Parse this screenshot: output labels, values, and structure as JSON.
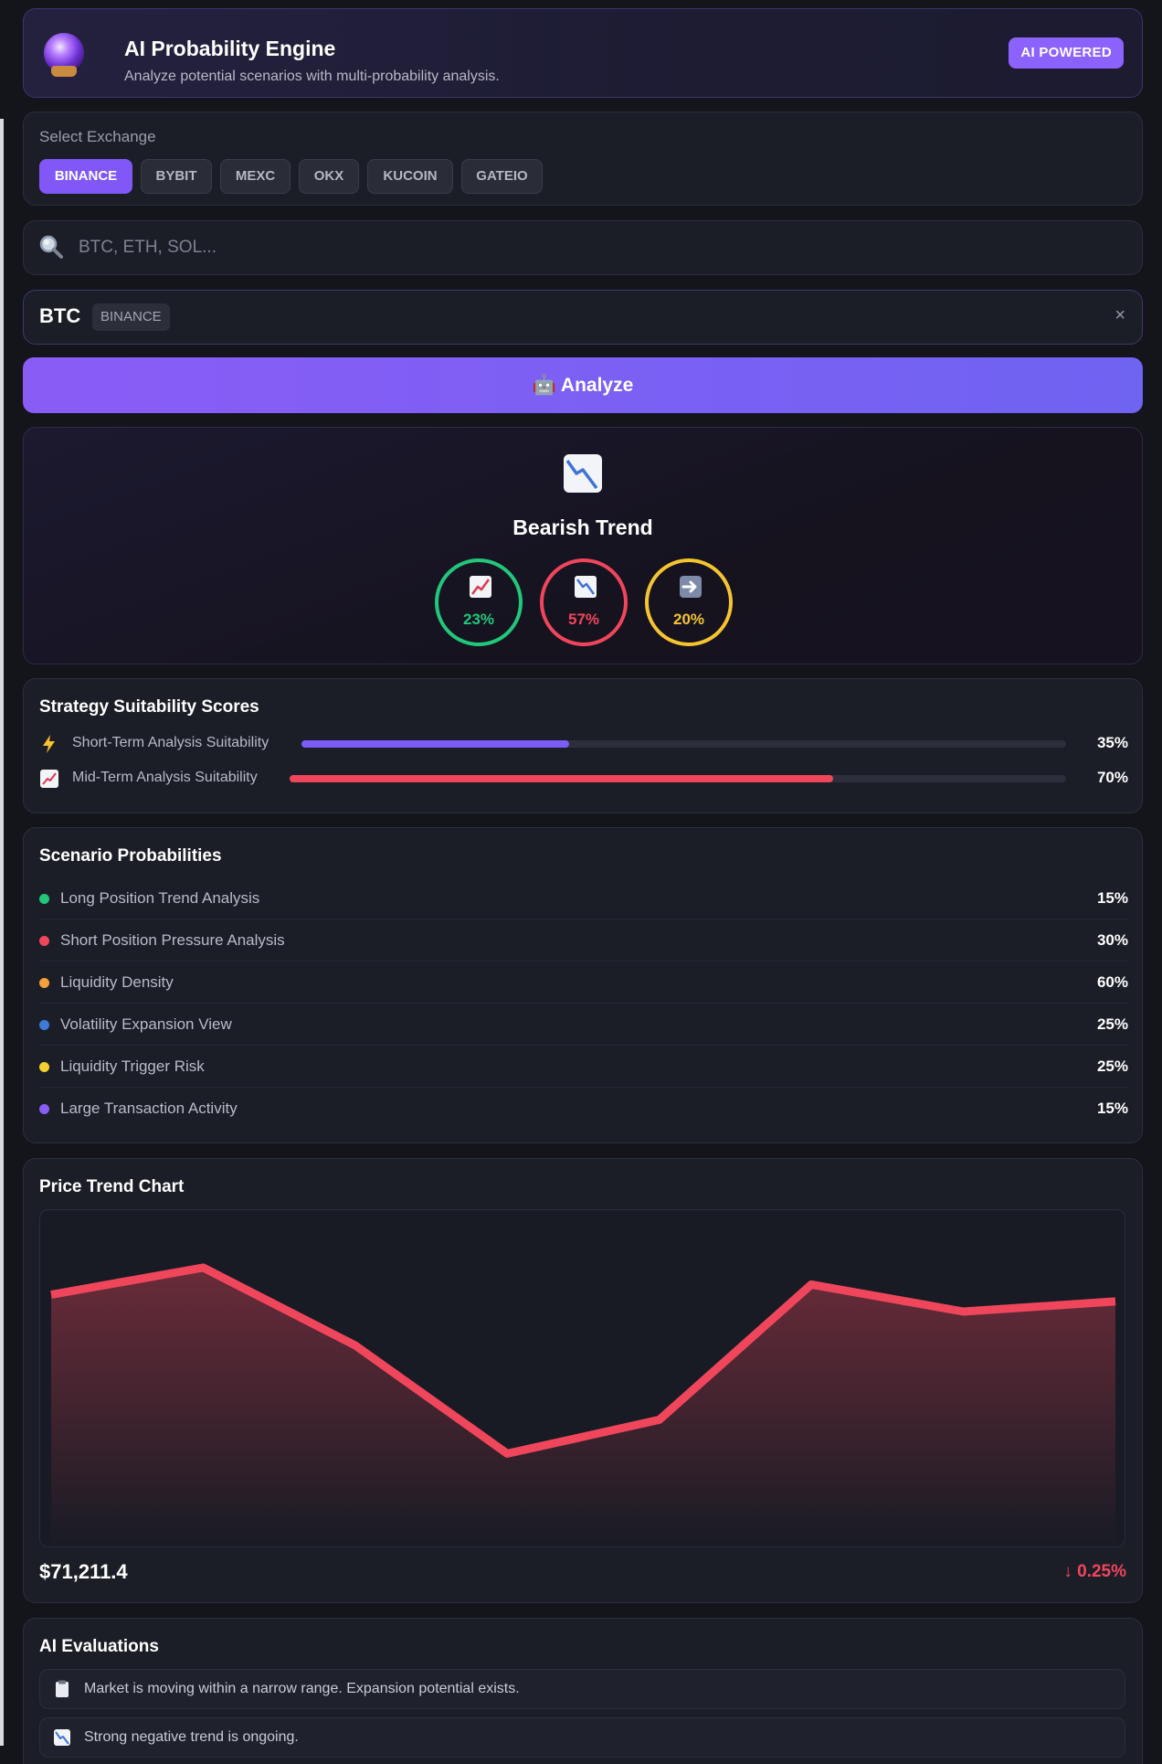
{
  "header": {
    "title": "AI Probability Engine",
    "subtitle": "Analyze potential scenarios with multi-probability analysis.",
    "badge": "AI POWERED",
    "icon": "crystal-ball-icon"
  },
  "exchange": {
    "label": "Select Exchange",
    "options": [
      "BINANCE",
      "BYBIT",
      "MEXC",
      "OKX",
      "KUCOIN",
      "GATEIO"
    ],
    "selected": "BINANCE"
  },
  "search": {
    "placeholder": "BTC, ETH, SOL...",
    "value": "",
    "icon": "search-icon"
  },
  "selection": {
    "symbol": "BTC",
    "exchange": "BINANCE",
    "close_label": "×"
  },
  "analyze": {
    "label": "🤖 Analyze"
  },
  "trend": {
    "title": "Bearish Trend",
    "icon": "chart-down-icon",
    "probabilities": [
      {
        "icon": "chart-up-icon",
        "value": "23%",
        "color": "#22c77a"
      },
      {
        "icon": "chart-down-icon",
        "value": "57%",
        "color": "#f0465c"
      },
      {
        "icon": "arrow-right-icon",
        "value": "20%",
        "color": "#f5c431"
      }
    ]
  },
  "strategy": {
    "title": "Strategy Suitability Scores",
    "items": [
      {
        "icon": "lightning-icon",
        "label": "Short-Term Analysis Suitability",
        "value": "35%",
        "fraction": 0.35,
        "color": "#7c5cf7"
      },
      {
        "icon": "chart-up-icon",
        "label": "Mid-Term Analysis Suitability",
        "value": "70%",
        "fraction": 0.7,
        "color": "#f0465c"
      }
    ]
  },
  "scenario": {
    "title": "Scenario Probabilities",
    "items": [
      {
        "label": "Long Position Trend Analysis",
        "value": "15%",
        "color": "#22c77a"
      },
      {
        "label": "Short Position Pressure Analysis",
        "value": "30%",
        "color": "#f0465c"
      },
      {
        "label": "Liquidity Density",
        "value": "60%",
        "color": "#f5a13b"
      },
      {
        "label": "Volatility Expansion View",
        "value": "25%",
        "color": "#3d7bd9"
      },
      {
        "label": "Liquidity Trigger Risk",
        "value": "25%",
        "color": "#f5d031"
      },
      {
        "label": "Large Transaction Activity",
        "value": "15%",
        "color": "#8a5cf6"
      }
    ]
  },
  "price_chart": {
    "title": "Price Trend Chart",
    "price": "$71,211.4",
    "change": "↓ 0.25%",
    "line_color": "#f0465c"
  },
  "chart_data": {
    "type": "area",
    "title": "Price Trend Chart",
    "x": [
      1,
      2,
      3,
      4,
      5,
      6,
      7,
      8
    ],
    "values": [
      0.75,
      0.83,
      0.6,
      0.28,
      0.38,
      0.78,
      0.7,
      0.73
    ],
    "ylim": [
      0,
      1
    ],
    "grid": false,
    "legend": "none"
  },
  "evaluations": {
    "title": "AI Evaluations",
    "items": [
      {
        "icon": "clipboard-icon",
        "text": "Market is moving within a narrow range. Expansion potential exists."
      },
      {
        "icon": "chart-down-icon",
        "text": "Strong negative trend is ongoing."
      }
    ]
  }
}
